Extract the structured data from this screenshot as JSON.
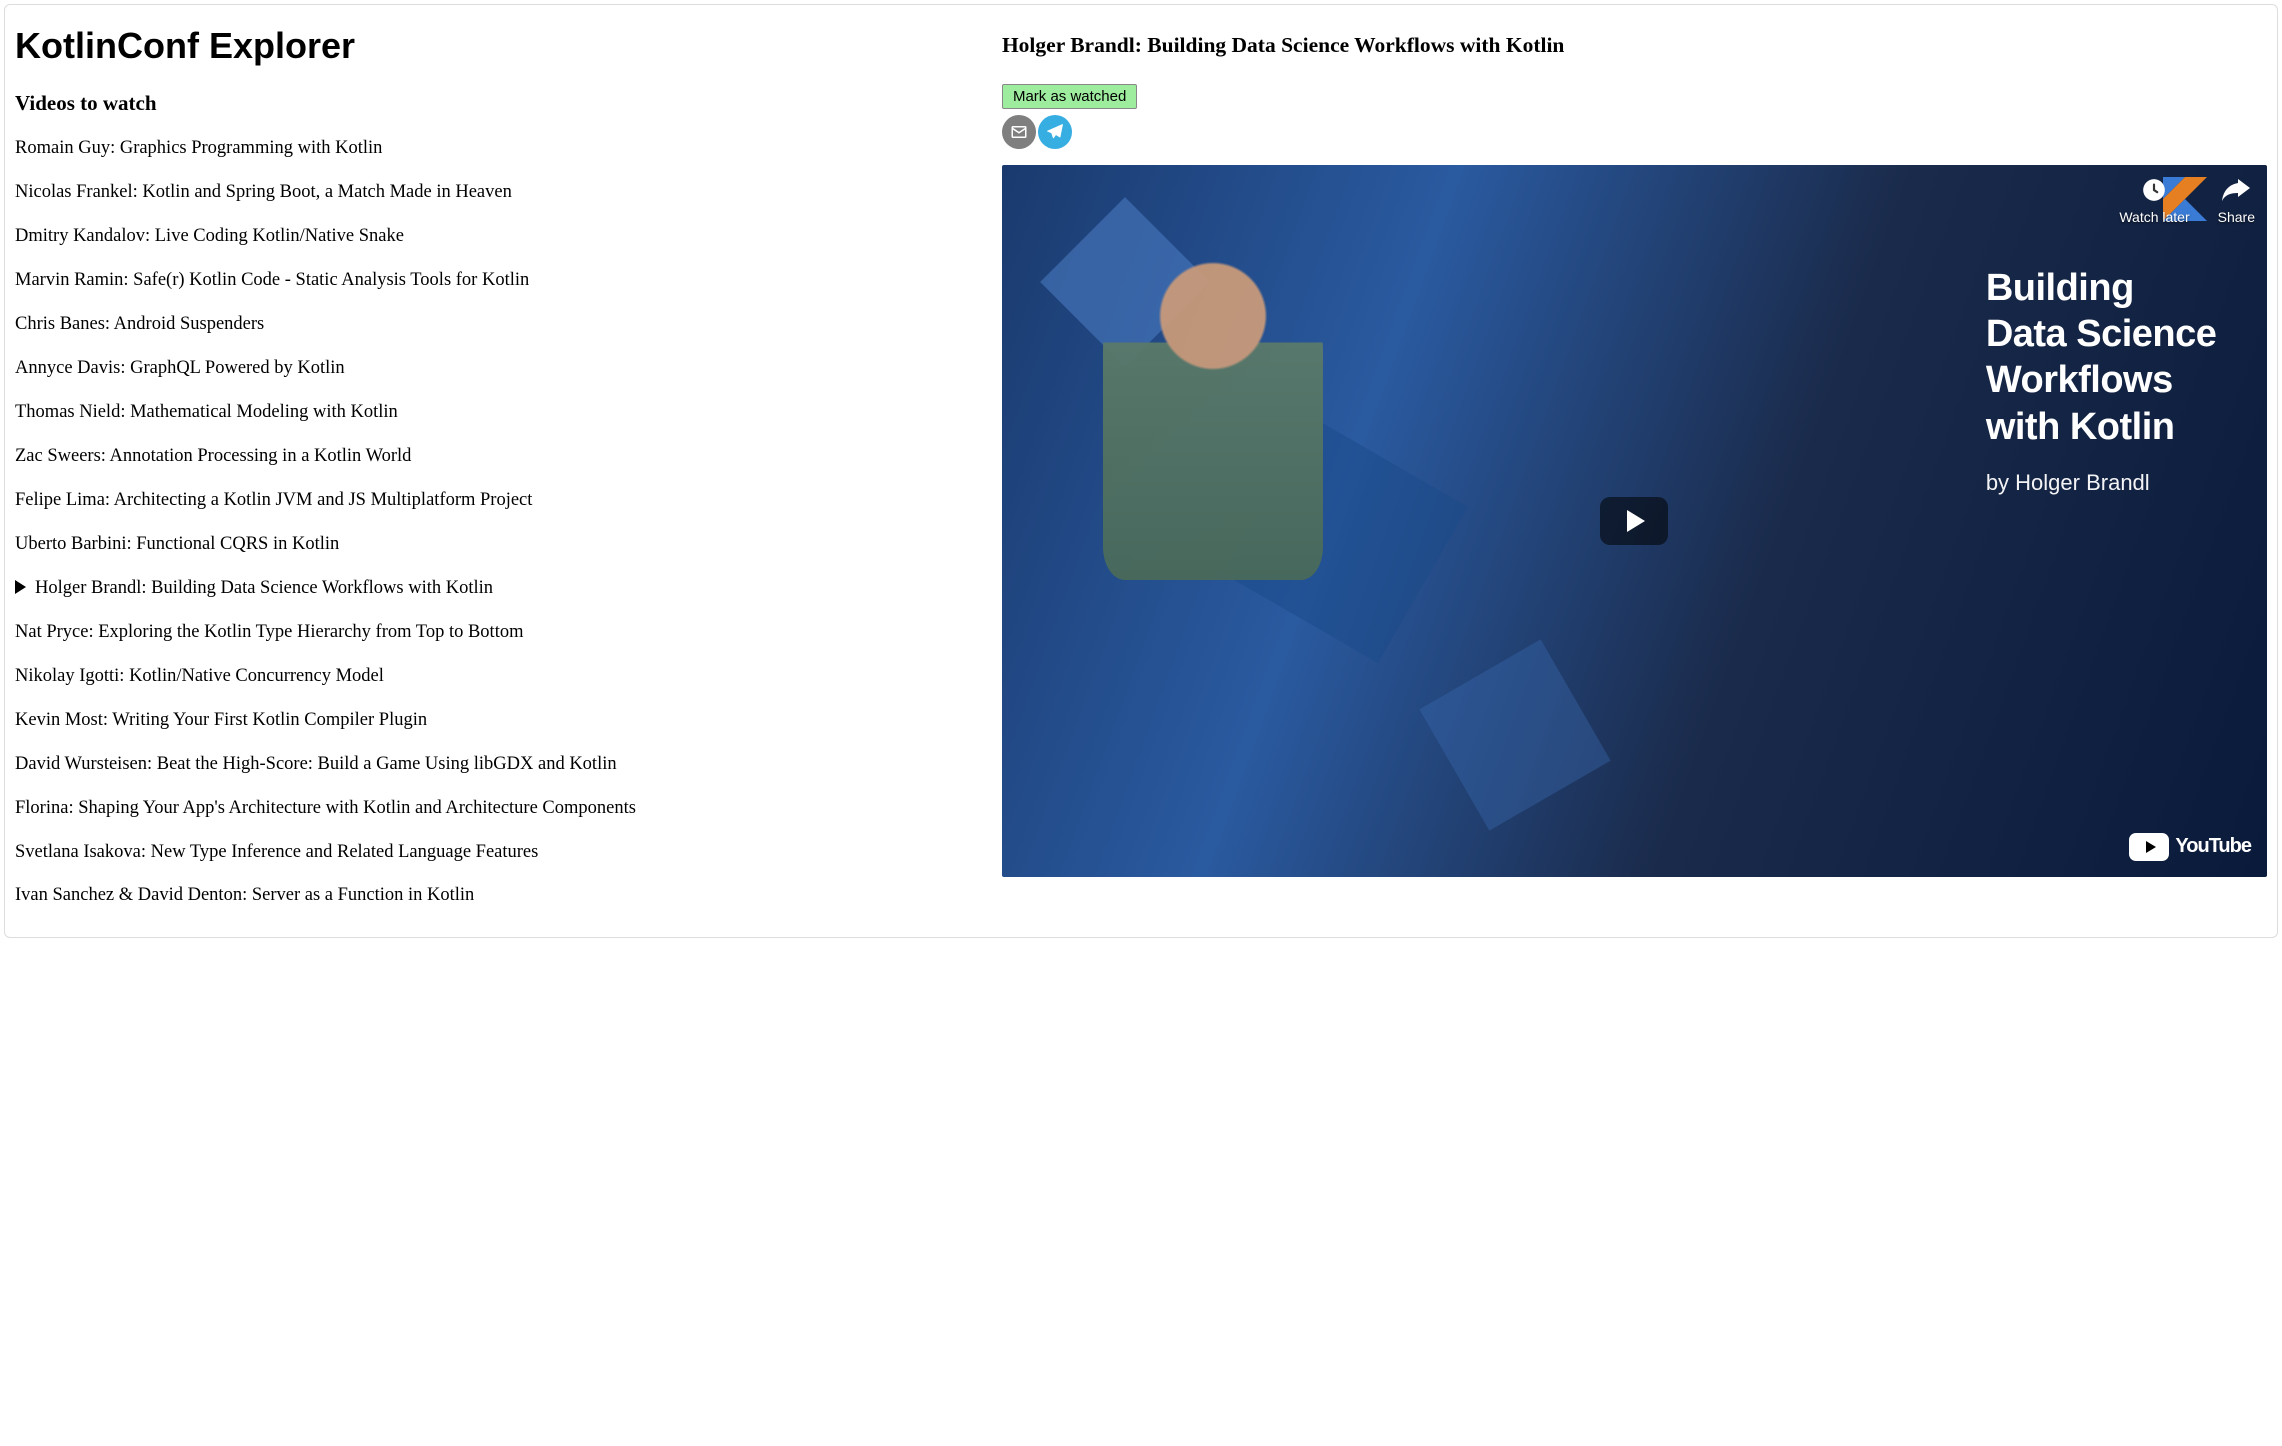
{
  "app": {
    "title": "KotlinConf Explorer"
  },
  "sidebar": {
    "heading": "Videos to watch",
    "selected_index": 10,
    "videos": [
      "Romain Guy: Graphics Programming with Kotlin",
      "Nicolas Frankel: Kotlin and Spring Boot, a Match Made in Heaven",
      "Dmitry Kandalov: Live Coding Kotlin/Native Snake",
      "Marvin Ramin: Safe(r) Kotlin Code - Static Analysis Tools for Kotlin",
      "Chris Banes: Android Suspenders",
      "Annyce Davis: GraphQL Powered by Kotlin",
      "Thomas Nield: Mathematical Modeling with Kotlin",
      "Zac Sweers: Annotation Processing in a Kotlin World",
      "Felipe Lima: Architecting a Kotlin JVM and JS Multiplatform Project",
      "Uberto Barbini: Functional CQRS in Kotlin",
      "Holger Brandl: Building Data Science Workflows with Kotlin",
      "Nat Pryce: Exploring the Kotlin Type Hierarchy from Top to Bottom",
      "Nikolay Igotti: Kotlin/Native Concurrency Model",
      "Kevin Most: Writing Your First Kotlin Compiler Plugin",
      "David Wursteisen: Beat the High-Score: Build a Game Using libGDX and Kotlin",
      "Florina: Shaping Your App's Architecture with Kotlin and Architecture Components",
      "Svetlana Isakova: New Type Inference and Related Language Features",
      "Ivan Sanchez & David Denton: Server as a Function in Kotlin"
    ]
  },
  "detail": {
    "title": "Holger Brandl: Building Data Science Workflows with Kotlin",
    "mark_watched_label": "Mark as watched",
    "share": {
      "email_icon": "email-icon",
      "telegram_icon": "telegram-icon"
    },
    "player": {
      "thumbnail_title_l1": "Building",
      "thumbnail_title_l2": "Data Science",
      "thumbnail_title_l3": "Workflows",
      "thumbnail_title_l4": "with Kotlin",
      "byline": "by Holger Brandl",
      "watch_later_label": "Watch later",
      "share_label": "Share",
      "youtube_label": "YouTube"
    }
  }
}
